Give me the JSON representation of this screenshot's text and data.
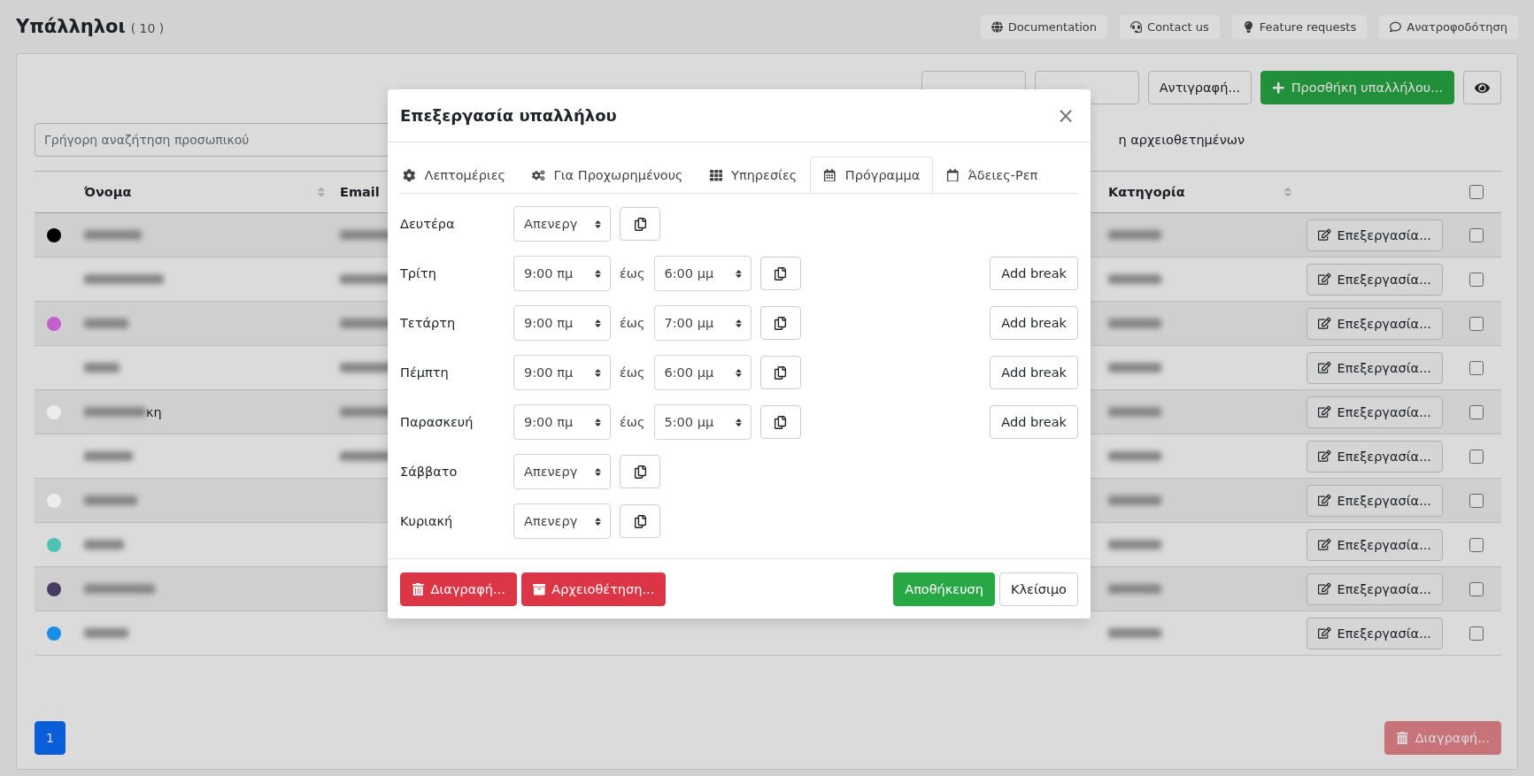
{
  "page": {
    "title": "Υπάλληλοι",
    "count": "( 10 )"
  },
  "header_links": [
    {
      "label": "Documentation"
    },
    {
      "label": "Contact us"
    },
    {
      "label": "Feature requests"
    },
    {
      "label": "Ανατροφοδότηση"
    }
  ],
  "toolbar": {
    "copy": "Αντιγραφή...",
    "add": "Προσθήκη υπαλλήλου..."
  },
  "search": {
    "placeholder": "Γρήγορη αναζήτηση προσωπικού"
  },
  "archived_label": "η αρχειοθετημένων",
  "table": {
    "columns": [
      "Όνομα",
      "Email",
      "Κατηγορία"
    ],
    "header_checked": false,
    "rows": [
      {
        "color": "#000000",
        "email_blurred": true,
        "action": "Επεξεργασία...",
        "checked": false
      },
      {
        "email_blurred": true,
        "action": "Επεξεργασία...",
        "checked": false
      },
      {
        "color": "#c45fd0",
        "email_blurred": true,
        "action": "Επεξεργασία...",
        "checked": false
      },
      {
        "email_blurred": true,
        "action": "Επεξεργασία...",
        "checked": false
      },
      {
        "color": "#ececec",
        "name_tail": "κη",
        "email_blurred": true,
        "action": "Επεξεργασία...",
        "checked": false
      },
      {
        "email_blurred": true,
        "action": "Επεξεργασία...",
        "checked": false
      },
      {
        "color": "#ececec",
        "email_blurred": false,
        "action": "Επεξεργασία...",
        "checked": false
      },
      {
        "color": "#4fc3b0",
        "email_blurred": false,
        "action": "Επεξεργασία...",
        "checked": false
      },
      {
        "color": "#4a3b63",
        "email_blurred": false,
        "action": "Επεξεργασία...",
        "checked": false
      },
      {
        "color": "#1a8ee6",
        "email_blurred": false,
        "action": "Επεξεργασία...",
        "checked": false
      }
    ]
  },
  "pagination": [
    {
      "label": "1",
      "selected": true
    }
  ],
  "bulk_delete": {
    "label": "Διαγραφή...",
    "disabled": true
  },
  "modal": {
    "title": "Επεξεργασία υπαλλήλου",
    "close": "×",
    "tabs": [
      {
        "label": "Λεπτομέριες",
        "selected": false
      },
      {
        "label": "Για Προχωρημένους",
        "selected": false
      },
      {
        "label": "Υπηρεσίες",
        "selected": false
      },
      {
        "label": "Πρόγραμμα",
        "selected": true
      },
      {
        "label": "Άδειες-Ρεπ",
        "selected": false
      }
    ],
    "days": [
      {
        "day": "Δευτέρα",
        "kind": "off",
        "value": "Απενεργ"
      },
      {
        "day": "Τρίτη",
        "kind": "hours",
        "from": "9:00 πμ",
        "separator": "έως",
        "to": "6:00 μμ",
        "break": "Add break"
      },
      {
        "day": "Τετάρτη",
        "kind": "hours",
        "from": "9:00 πμ",
        "separator": "έως",
        "to": "7:00 μμ",
        "break": "Add break"
      },
      {
        "day": "Πέμπτη",
        "kind": "hours",
        "from": "9:00 πμ",
        "separator": "έως",
        "to": "6:00 μμ",
        "break": "Add break"
      },
      {
        "day": "Παρασκευή",
        "kind": "hours",
        "from": "9:00 πμ",
        "separator": "έως",
        "to": "5:00 μμ",
        "break": "Add break"
      },
      {
        "day": "Σάββατο",
        "kind": "off",
        "value": "Απενεργ"
      },
      {
        "day": "Κυριακή",
        "kind": "off",
        "value": "Απενεργ"
      }
    ],
    "footer": {
      "delete": "Διαγραφή...",
      "archive": "Αρχειοθέτηση...",
      "save": "Αποθήκευση",
      "close": "Κλείσιμο"
    }
  }
}
